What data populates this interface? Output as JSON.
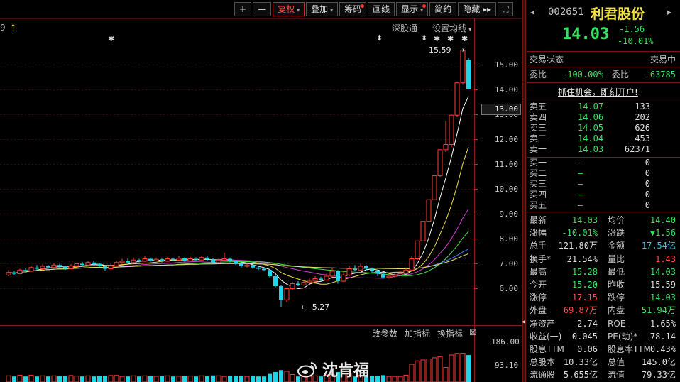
{
  "toolbar": {
    "buttons": [
      {
        "label": "+",
        "dot": false,
        "caret": false,
        "active": false
      },
      {
        "label": "—",
        "dot": false,
        "caret": false,
        "active": false
      },
      {
        "label": "复权",
        "dot": false,
        "caret": true,
        "active": true
      },
      {
        "label": "叠加",
        "dot": false,
        "caret": true,
        "active": false
      },
      {
        "label": "筹码",
        "dot": true,
        "caret": false,
        "active": false
      },
      {
        "label": "画线",
        "dot": false,
        "caret": false,
        "active": false
      },
      {
        "label": "显示",
        "dot": true,
        "caret": true,
        "active": false
      },
      {
        "label": "简约",
        "dot": false,
        "caret": false,
        "active": false
      },
      {
        "label": "隐藏 ▸▸",
        "dot": false,
        "caret": false,
        "active": false
      },
      {
        "label": "⛶",
        "dot": false,
        "caret": false,
        "active": false
      }
    ]
  },
  "chart_header": {
    "ma_label_fragment": "9",
    "arrow": "↑",
    "exchange_link": "深股通",
    "ma_settings": "设置均线",
    "ma_settings_caret": "▾"
  },
  "chart_annotations": {
    "high_label": "15.59",
    "low_label": "5.27",
    "current_price_tag": "13.00",
    "marker_star": "✱",
    "marker_arrow": "⬍"
  },
  "price_axis": {
    "ticks": [
      "15.00",
      "14.00",
      "13.00",
      "12.00",
      "11.00",
      "10.00",
      "9.00",
      "8.00",
      "7.00",
      "6.00"
    ]
  },
  "volume_panel": {
    "buttons": [
      "改参数",
      "加指标",
      "换指标"
    ],
    "close_glyph": "⊠",
    "ticks": [
      "186.00",
      "93.10"
    ]
  },
  "watermark": {
    "text": "沈肯福",
    "icon": "weibo-icon"
  },
  "chart_data": {
    "type": "candlestick",
    "ylim": [
      5.27,
      15.59
    ],
    "y_ticks": [
      6,
      7,
      8,
      9,
      10,
      11,
      12,
      13,
      14,
      15
    ],
    "high": 15.59,
    "low": 5.27,
    "last_close": 14.03,
    "candles": [
      [
        6.55,
        6.65,
        6.75,
        6.5
      ],
      [
        6.65,
        6.6,
        6.72,
        6.55
      ],
      [
        6.6,
        6.75,
        6.8,
        6.58
      ],
      [
        6.75,
        6.7,
        6.82,
        6.65
      ],
      [
        6.7,
        6.85,
        6.9,
        6.68
      ],
      [
        6.85,
        6.8,
        6.95,
        6.75
      ],
      [
        6.8,
        6.9,
        6.98,
        6.78
      ],
      [
        6.9,
        6.85,
        6.95,
        6.8
      ],
      [
        6.85,
        6.95,
        7.02,
        6.82
      ],
      [
        6.95,
        6.88,
        7.0,
        6.84
      ],
      [
        6.88,
        6.8,
        6.92,
        6.75
      ],
      [
        6.8,
        6.92,
        6.98,
        6.78
      ],
      [
        6.92,
        7.0,
        7.05,
        6.9
      ],
      [
        7.0,
        6.95,
        7.08,
        6.9
      ],
      [
        6.95,
        7.05,
        7.1,
        6.92
      ],
      [
        7.05,
        7.0,
        7.12,
        6.95
      ],
      [
        7.0,
        6.9,
        7.04,
        6.85
      ],
      [
        6.9,
        6.8,
        6.95,
        6.72
      ],
      [
        6.8,
        6.92,
        6.98,
        6.78
      ],
      [
        6.92,
        7.05,
        7.12,
        6.9
      ],
      [
        7.05,
        7.1,
        7.2,
        7.0
      ],
      [
        7.1,
        7.05,
        7.22,
        7.0
      ],
      [
        7.05,
        7.15,
        7.25,
        7.02
      ],
      [
        7.15,
        7.1,
        7.2,
        7.05
      ],
      [
        7.1,
        7.2,
        7.3,
        7.08
      ],
      [
        7.2,
        7.12,
        7.25,
        7.08
      ],
      [
        7.12,
        7.18,
        7.25,
        7.1
      ],
      [
        7.18,
        7.1,
        7.22,
        7.05
      ],
      [
        7.1,
        7.2,
        7.28,
        7.08
      ],
      [
        7.2,
        7.15,
        7.25,
        7.1
      ],
      [
        7.15,
        7.22,
        7.3,
        7.12
      ],
      [
        7.22,
        7.12,
        7.26,
        7.08
      ],
      [
        7.12,
        7.2,
        7.28,
        7.1
      ],
      [
        7.2,
        7.15,
        7.26,
        7.1
      ],
      [
        7.15,
        7.25,
        7.32,
        7.12
      ],
      [
        7.25,
        7.18,
        7.3,
        7.12
      ],
      [
        7.18,
        7.05,
        7.22,
        7.0
      ],
      [
        7.05,
        7.15,
        7.2,
        7.02
      ],
      [
        7.15,
        7.2,
        7.45,
        7.12
      ],
      [
        7.2,
        7.1,
        7.25,
        7.05
      ],
      [
        7.1,
        7.0,
        7.15,
        6.95
      ],
      [
        7.0,
        6.9,
        7.05,
        6.85
      ],
      [
        6.9,
        6.95,
        7.0,
        6.85
      ],
      [
        6.95,
        6.85,
        6.98,
        6.8
      ],
      [
        6.85,
        6.8,
        6.9,
        6.75
      ],
      [
        6.8,
        6.75,
        6.85,
        6.7
      ],
      [
        6.75,
        6.5,
        6.78,
        6.45
      ],
      [
        6.5,
        6.1,
        6.55,
        6.05
      ],
      [
        6.1,
        5.55,
        6.15,
        5.27
      ],
      [
        5.55,
        6.0,
        6.05,
        5.45
      ],
      [
        6.0,
        6.2,
        6.28,
        5.95
      ],
      [
        6.2,
        6.15,
        6.3,
        6.1
      ],
      [
        6.15,
        6.25,
        6.35,
        6.12
      ],
      [
        6.25,
        6.3,
        6.4,
        6.2
      ],
      [
        6.3,
        6.4,
        6.5,
        6.25
      ],
      [
        6.4,
        6.35,
        6.48,
        6.3
      ],
      [
        6.35,
        6.5,
        6.6,
        6.32
      ],
      [
        6.5,
        6.7,
        6.85,
        6.45
      ],
      [
        6.7,
        6.3,
        6.75,
        6.2
      ],
      [
        6.3,
        6.55,
        6.7,
        6.28
      ],
      [
        6.55,
        6.8,
        6.9,
        6.5
      ],
      [
        6.8,
        6.75,
        6.95,
        6.7
      ],
      [
        6.75,
        6.9,
        7.0,
        6.72
      ],
      [
        6.9,
        6.8,
        6.95,
        6.75
      ],
      [
        6.8,
        6.7,
        6.85,
        6.6
      ],
      [
        6.7,
        6.6,
        6.75,
        6.5
      ],
      [
        6.6,
        6.45,
        6.65,
        6.4
      ],
      [
        6.45,
        6.5,
        6.58,
        6.4
      ],
      [
        6.5,
        6.55,
        6.62,
        6.45
      ],
      [
        6.55,
        6.6,
        6.7,
        6.52
      ],
      [
        6.6,
        6.75,
        6.85,
        6.58
      ],
      [
        6.75,
        7.2,
        7.3,
        6.72
      ],
      [
        7.2,
        7.92,
        7.92,
        7.15
      ],
      [
        7.92,
        8.71,
        8.71,
        7.9
      ],
      [
        8.71,
        9.58,
        9.58,
        8.7
      ],
      [
        9.58,
        10.54,
        10.54,
        9.55
      ],
      [
        10.54,
        11.59,
        11.59,
        10.5
      ],
      [
        11.59,
        11.8,
        12.75,
        11.5
      ],
      [
        11.8,
        12.98,
        13.0,
        11.7
      ],
      [
        12.98,
        14.28,
        14.28,
        12.9
      ],
      [
        14.28,
        15.59,
        15.59,
        14.2
      ],
      [
        15.2,
        14.03,
        15.28,
        14.03
      ]
    ]
  },
  "quote": {
    "code": "002651",
    "name": "利君股份",
    "price": "14.03",
    "change": "-1.56",
    "change_pct": "-10.01%",
    "status_label": "交易状态",
    "status_value": "交易中",
    "weibi_label": "委比",
    "weibi_value": "-100.00%",
    "weicha_label": "委差",
    "weicha_value": "-63785",
    "promo": "抓住机会，即刻开户!",
    "asks": [
      {
        "label": "卖五",
        "price": "14.07",
        "vol": "133"
      },
      {
        "label": "卖四",
        "price": "14.06",
        "vol": "202"
      },
      {
        "label": "卖三",
        "price": "14.05",
        "vol": "626"
      },
      {
        "label": "卖二",
        "price": "14.04",
        "vol": "453"
      },
      {
        "label": "卖一",
        "price": "14.03",
        "vol": "62371"
      }
    ],
    "bids": [
      {
        "label": "买一",
        "price": "—",
        "vol": "0"
      },
      {
        "label": "买二",
        "price": "—",
        "vol": "0"
      },
      {
        "label": "买三",
        "price": "—",
        "vol": "0"
      },
      {
        "label": "买四",
        "price": "—",
        "vol": "0"
      },
      {
        "label": "买五",
        "price": "—",
        "vol": "0"
      }
    ],
    "stats": [
      {
        "l1": "最新",
        "v1": "14.03",
        "c1": "g",
        "l2": "均价",
        "v2": "14.40",
        "c2": "g"
      },
      {
        "l1": "涨幅",
        "v1": "-10.01%",
        "c1": "g",
        "l2": "涨跌",
        "v2": "▼1.56",
        "c2": "g"
      },
      {
        "l1": "总手",
        "v1": "121.80万",
        "c1": "w",
        "l2": "金额",
        "v2": "17.54亿",
        "c2": "c"
      },
      {
        "l1": "换手*",
        "v1": "21.54%",
        "c1": "w",
        "l2": "量比",
        "v2": "1.43",
        "c2": "r"
      },
      {
        "l1": "最高",
        "v1": "15.28",
        "c1": "g",
        "l2": "最低",
        "v2": "14.03",
        "c2": "g"
      },
      {
        "l1": "今开",
        "v1": "15.20",
        "c1": "g",
        "l2": "昨收",
        "v2": "15.59",
        "c2": "w"
      },
      {
        "l1": "涨停",
        "v1": "17.15",
        "c1": "r",
        "l2": "跌停",
        "v2": "14.03",
        "c2": "g"
      },
      {
        "l1": "外盘",
        "v1": "69.87万",
        "c1": "r",
        "l2": "内盘",
        "v2": "51.94万",
        "c2": "g"
      },
      {
        "l1": "净资产",
        "v1": "2.74",
        "c1": "w",
        "l2": "ROE",
        "v2": "1.65%",
        "c2": "w"
      },
      {
        "l1": "收益(一)",
        "v1": "0.045",
        "c1": "w",
        "l2": "PE(动)*",
        "v2": "78.14",
        "c2": "w"
      },
      {
        "l1": "股息TTM",
        "v1": "0.06",
        "c1": "w",
        "l2": "股息率TTM",
        "v2": "0.43%",
        "c2": "w"
      },
      {
        "l1": "总股本",
        "v1": "10.33亿",
        "c1": "w",
        "l2": "总值",
        "v2": "145.0亿",
        "c2": "w"
      },
      {
        "l1": "流通股",
        "v1": "5.655亿",
        "c1": "w",
        "l2": "流值",
        "v2": "79.33亿",
        "c2": "w"
      }
    ]
  }
}
